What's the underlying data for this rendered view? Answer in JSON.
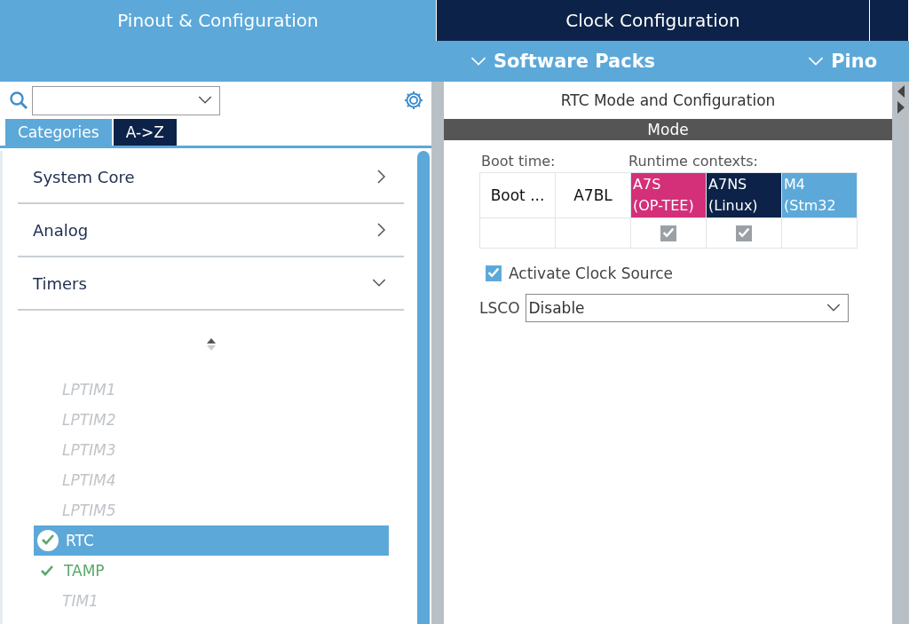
{
  "tabs": [
    {
      "label": "Pinout & Configuration",
      "selected": true
    },
    {
      "label": "Clock Configuration",
      "selected": false
    },
    {
      "selected": false
    }
  ],
  "menus": [
    {
      "label": "Software Packs"
    },
    {
      "label": "Pino"
    }
  ],
  "sidebar": {
    "view_tabs": [
      {
        "label": "Categories",
        "selected": true
      },
      {
        "label": "A->Z",
        "selected": false
      }
    ],
    "categories": [
      {
        "label": "System Core",
        "expanded": false
      },
      {
        "label": "Analog",
        "expanded": false
      },
      {
        "label": "Timers",
        "expanded": true,
        "children": [
          {
            "label": "LPTIM1",
            "kind": "disabled",
            "selected": false
          },
          {
            "label": "LPTIM2",
            "kind": "disabled",
            "selected": false
          },
          {
            "label": "LPTIM3",
            "kind": "disabled",
            "selected": false
          },
          {
            "label": "LPTIM4",
            "kind": "disabled",
            "selected": false
          },
          {
            "label": "LPTIM5",
            "kind": "disabled",
            "selected": false
          },
          {
            "label": "RTC",
            "kind": "configured",
            "selected": true
          },
          {
            "label": "TAMP",
            "kind": "configured",
            "selected": false
          },
          {
            "label": "TIM1",
            "kind": "disabled",
            "selected": false
          }
        ]
      }
    ]
  },
  "panel": {
    "title": "RTC Mode and Configuration",
    "section": "Mode",
    "boot_label": "Boot time:",
    "runtime_label": "Runtime contexts:",
    "columns": [
      {
        "kind": "plain",
        "label": "Boot ..."
      },
      {
        "kind": "plain",
        "label": "A7BL"
      },
      {
        "kind": "context",
        "label": "A7S",
        "sublabel": "(OP-TEE)",
        "color": "#d4307a",
        "checked": true
      },
      {
        "kind": "context",
        "label": "A7NS",
        "sublabel": "(Linux)",
        "color": "#0c2248",
        "checked": true
      },
      {
        "kind": "context",
        "label": "M4",
        "sublabel": "(Stm32",
        "color": "#5ca8d9",
        "checked": false
      }
    ],
    "activate": {
      "label": "Activate Clock Source",
      "checked": true
    },
    "lsco": {
      "label": "LSCO",
      "value": "Disable"
    }
  }
}
